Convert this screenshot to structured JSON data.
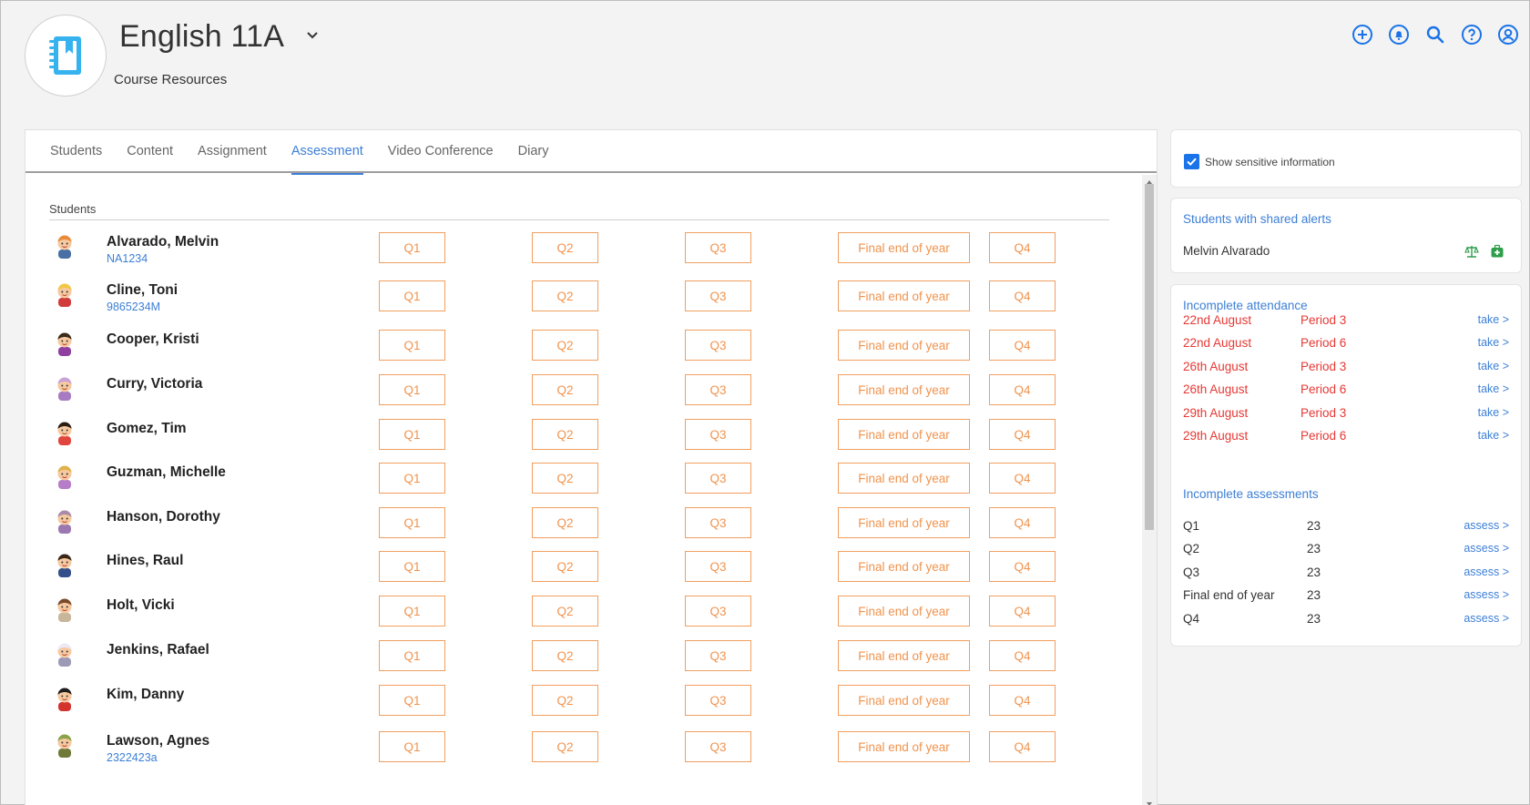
{
  "header": {
    "course_title": "English 11A",
    "course_subtitle": "Course Resources",
    "logo_icon": "notebook-icon",
    "actions": [
      "add-circle-icon",
      "bell-icon",
      "search-icon",
      "help-icon",
      "account-icon"
    ]
  },
  "tabs": [
    {
      "label": "Students",
      "active": false
    },
    {
      "label": "Content",
      "active": false
    },
    {
      "label": "Assignment",
      "active": false
    },
    {
      "label": "Assessment",
      "active": true
    },
    {
      "label": "Video Conference",
      "active": false
    },
    {
      "label": "Diary",
      "active": false
    }
  ],
  "assessment": {
    "students_label": "Students",
    "columns": [
      "Q1",
      "Q2",
      "Q3",
      "Final end of year",
      "Q4"
    ],
    "students": [
      {
        "name": "Alvarado, Melvin",
        "id": "NA1234",
        "hair": "#e88a3a",
        "shirt": "#4a6fa5"
      },
      {
        "name": "Cline, Toni",
        "id": "9865234M",
        "hair": "#f2c744",
        "shirt": "#d23b3b"
      },
      {
        "name": "Cooper, Kristi",
        "id": "",
        "hair": "#3a2a1a",
        "shirt": "#8e3fa0"
      },
      {
        "name": "Curry, Victoria",
        "id": "",
        "hair": "#c9a2d8",
        "shirt": "#a77bc2"
      },
      {
        "name": "Gomez, Tim",
        "id": "",
        "hair": "#2b1d12",
        "shirt": "#e0463f"
      },
      {
        "name": "Guzman, Michelle",
        "id": "",
        "hair": "#e0b24d",
        "shirt": "#b57cc8"
      },
      {
        "name": "Hanson, Dorothy",
        "id": "",
        "hair": "#a98aa8",
        "shirt": "#9c78b0"
      },
      {
        "name": "Hines, Raul",
        "id": "",
        "hair": "#3a2616",
        "shirt": "#34508a"
      },
      {
        "name": "Holt, Vicki",
        "id": "",
        "hair": "#7a4a2a",
        "shirt": "#c8b69a"
      },
      {
        "name": "Jenkins, Rafael",
        "id": "",
        "hair": "#ece8f5",
        "shirt": "#9d9ab8"
      },
      {
        "name": "Kim, Danny",
        "id": "",
        "hair": "#1e1e1e",
        "shirt": "#d3352e"
      },
      {
        "name": "Lawson, Agnes",
        "id": "2322423a",
        "hair": "#8aa34a",
        "shirt": "#6f7a3a"
      }
    ]
  },
  "sidebar": {
    "sensitive_label": "Show sensitive information",
    "sensitive_checked": true,
    "alerts_title": "Students with shared alerts",
    "alert_student": "Melvin Alvarado",
    "attendance_title": "Incomplete attendance",
    "attendance": [
      {
        "date": "22nd August",
        "period": "Period 3",
        "action": "take >"
      },
      {
        "date": "22nd August",
        "period": "Period 6",
        "action": "take >"
      },
      {
        "date": "26th August",
        "period": "Period 3",
        "action": "take >"
      },
      {
        "date": "26th August",
        "period": "Period 6",
        "action": "take >"
      },
      {
        "date": "29th August",
        "period": "Period 3",
        "action": "take >"
      },
      {
        "date": "29th August",
        "period": "Period 6",
        "action": "take >"
      }
    ],
    "assessments_title": "Incomplete assessments",
    "assessments": [
      {
        "name": "Q1",
        "count": "23",
        "action": "assess >"
      },
      {
        "name": "Q2",
        "count": "23",
        "action": "assess >"
      },
      {
        "name": "Q3",
        "count": "23",
        "action": "assess >"
      },
      {
        "name": "Final end of year",
        "count": "23",
        "action": "assess >"
      },
      {
        "name": "Q4",
        "count": "23",
        "action": "assess >"
      }
    ]
  },
  "colors": {
    "accent": "#3d7fd6",
    "assessment_btn": "#f0934d",
    "alert_red": "#e53935",
    "alert_icon_green": "#2e9e4a"
  }
}
